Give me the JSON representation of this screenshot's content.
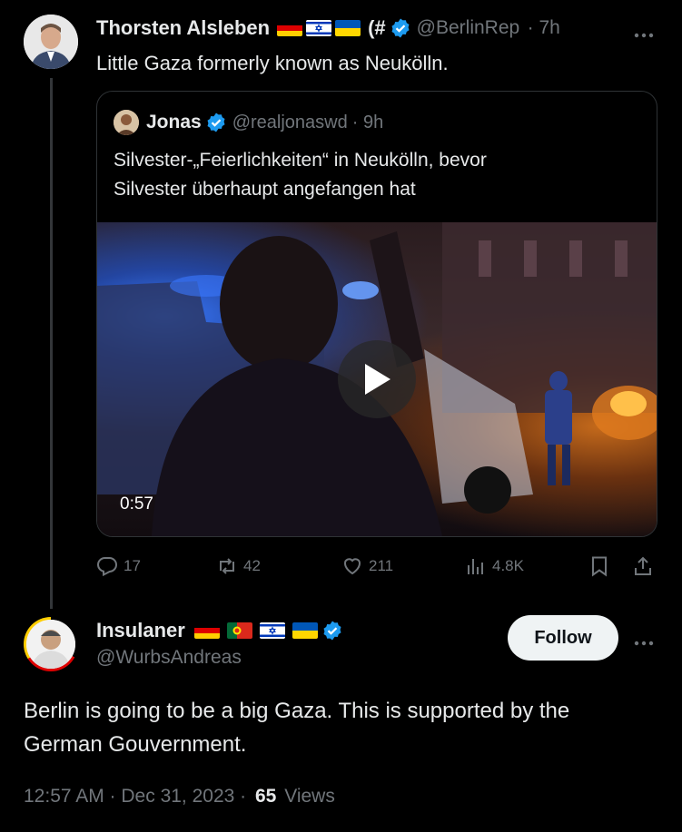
{
  "parent_tweet": {
    "name": "Thorsten Alsleben",
    "name_suffix": "(#",
    "handle": "@BerlinRep",
    "time": "· 7h",
    "text": "Little Gaza formerly known as Neukölln."
  },
  "quoted_tweet": {
    "name": "Jonas",
    "handle": "@realjonaswd",
    "time": "· 9h",
    "text_line1": "Silvester-„Feierlichkeiten“ in Neukölln, bevor",
    "text_line2": "Silvester überhaupt angefangen hat",
    "video_duration": "0:57"
  },
  "actions": {
    "replies": "17",
    "reposts": "42",
    "likes": "211",
    "views": "4.8K"
  },
  "main_tweet": {
    "name": "Insulaner",
    "handle": "@WurbsAndreas",
    "follow_label": "Follow",
    "text_line1": "Berlin is going to be a big Gaza. This is supported by the",
    "text_line2": "German Gouvernment.",
    "timestamp": "12:57 AM · Dec 31, 2023 ·",
    "views_count": "65",
    "views_label": "Views"
  },
  "colors": {
    "background": "#000000",
    "text": "#e7e9ea",
    "muted": "#71767b",
    "verified": "#1d9bf0",
    "border": "#2f3336"
  },
  "icons": [
    "verified-badge-icon",
    "more-icon",
    "play-icon",
    "reply-icon",
    "repost-icon",
    "like-icon",
    "analytics-icon",
    "bookmark-icon",
    "share-icon"
  ]
}
